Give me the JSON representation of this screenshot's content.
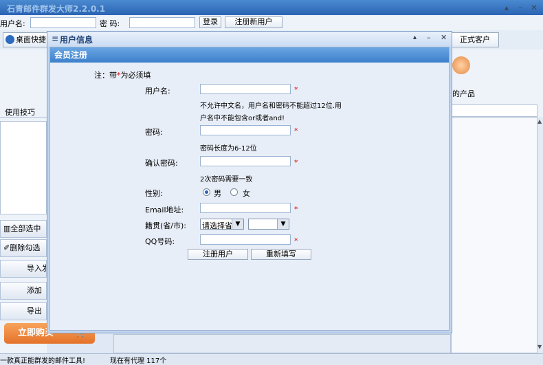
{
  "app": {
    "title": "石青邮件群发大师2.2.0.1"
  },
  "login": {
    "username_label": "用户名:",
    "password_label": "密  码:",
    "login_btn": "登录",
    "register_btn": "注册新用户"
  },
  "toolbar": {
    "desktop_shortcut": "桌面快捷",
    "formal_customer": "正式客户"
  },
  "sidebar": {
    "tips": "使用技巧",
    "buttons": [
      "全部选中",
      "删除勾选",
      "导入发",
      "添加",
      "导出"
    ],
    "buy": "立即购买"
  },
  "right_panel": {
    "product_label": "的产品"
  },
  "status": {
    "left": "一款真正能群发的邮件工具!",
    "middle": "现在有代理 117个"
  },
  "dialog_userinfo": {
    "title": "用户信息"
  },
  "dialog_register": {
    "title": "会员注册",
    "note_prefix": "注：带",
    "note_star": "*",
    "note_suffix": "为必须填",
    "username_label": "用户名:",
    "username_hint1": "不允许中文名，用户名和密码不能超过12位.用",
    "username_hint2": "户名中不能包含or或者and!",
    "password_label": "密码:",
    "password_hint": "密码长度为6-12位",
    "confirm_label": "确认密码:",
    "confirm_hint": "2次密码需要一致",
    "gender_label": "性别:",
    "gender_male": "男",
    "gender_female": "女",
    "gender_selected": "男",
    "email_label": "Email地址:",
    "region_label": "籍贯(省/市):",
    "province_value": "请选择省",
    "city_value": "",
    "qq_label": "QQ号码:",
    "submit_btn": "注册用户",
    "reset_btn": "重新填写",
    "required_mark": "*"
  }
}
